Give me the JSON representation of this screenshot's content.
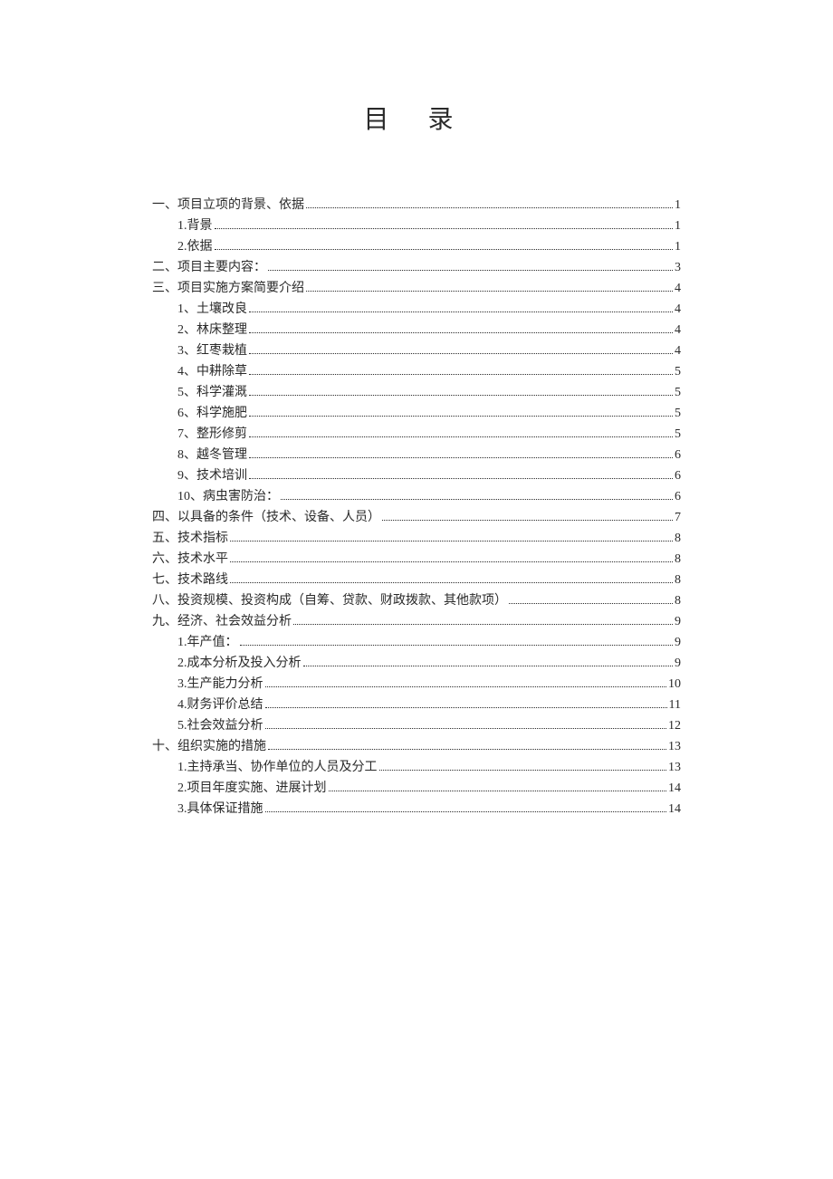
{
  "title": "目  录",
  "toc": [
    {
      "level": 1,
      "label": "一、项目立项的背景、依据",
      "page": "1"
    },
    {
      "level": 2,
      "label": "1.背景",
      "page": "1"
    },
    {
      "level": 2,
      "label": "2.依据",
      "page": "1"
    },
    {
      "level": 1,
      "label": "二、项目主要内容：",
      "page": "3"
    },
    {
      "level": 1,
      "label": "三、项目实施方案简要介绍",
      "page": "4"
    },
    {
      "level": 2,
      "label": "1、土壤改良",
      "page": "4"
    },
    {
      "level": 2,
      "label": "2、林床整理",
      "page": "4"
    },
    {
      "level": 2,
      "label": "3、红枣栽植",
      "page": "4"
    },
    {
      "level": 2,
      "label": "4、中耕除草",
      "page": "5"
    },
    {
      "level": 2,
      "label": "5、科学灌溉",
      "page": "5"
    },
    {
      "level": 2,
      "label": "6、科学施肥",
      "page": "5"
    },
    {
      "level": 2,
      "label": "7、整形修剪",
      "page": "5"
    },
    {
      "level": 2,
      "label": "8、越冬管理",
      "page": "6"
    },
    {
      "level": 2,
      "label": "9、技术培训",
      "page": "6"
    },
    {
      "level": 2,
      "label": "10、病虫害防治：",
      "page": "6"
    },
    {
      "level": 1,
      "label": "四、以具备的条件（技术、设备、人员）",
      "page": "7"
    },
    {
      "level": 1,
      "label": "五、技术指标",
      "page": "8"
    },
    {
      "level": 1,
      "label": "六、技术水平",
      "page": "8"
    },
    {
      "level": 1,
      "label": "七、技术路线",
      "page": "8"
    },
    {
      "level": 1,
      "label": "八、投资规模、投资构成（自筹、贷款、财政拨款、其他款项）",
      "page": "8"
    },
    {
      "level": 1,
      "label": "九、经济、社会效益分析",
      "page": "9"
    },
    {
      "level": 2,
      "label": "1.年产值：",
      "page": "9"
    },
    {
      "level": 2,
      "label": "2.成本分析及投入分析",
      "page": "9"
    },
    {
      "level": 2,
      "label": "3.生产能力分析",
      "page": "10"
    },
    {
      "level": 2,
      "label": "4.财务评价总结",
      "page": "11"
    },
    {
      "level": 2,
      "label": "5.社会效益分析",
      "page": "12"
    },
    {
      "level": 1,
      "label": "十、组织实施的措施",
      "page": "13"
    },
    {
      "level": 2,
      "label": "1.主持承当、协作单位的人员及分工",
      "page": "13"
    },
    {
      "level": 2,
      "label": "2.项目年度实施、进展计划",
      "page": "14"
    },
    {
      "level": 2,
      "label": "3.具体保证措施",
      "page": "14"
    }
  ]
}
